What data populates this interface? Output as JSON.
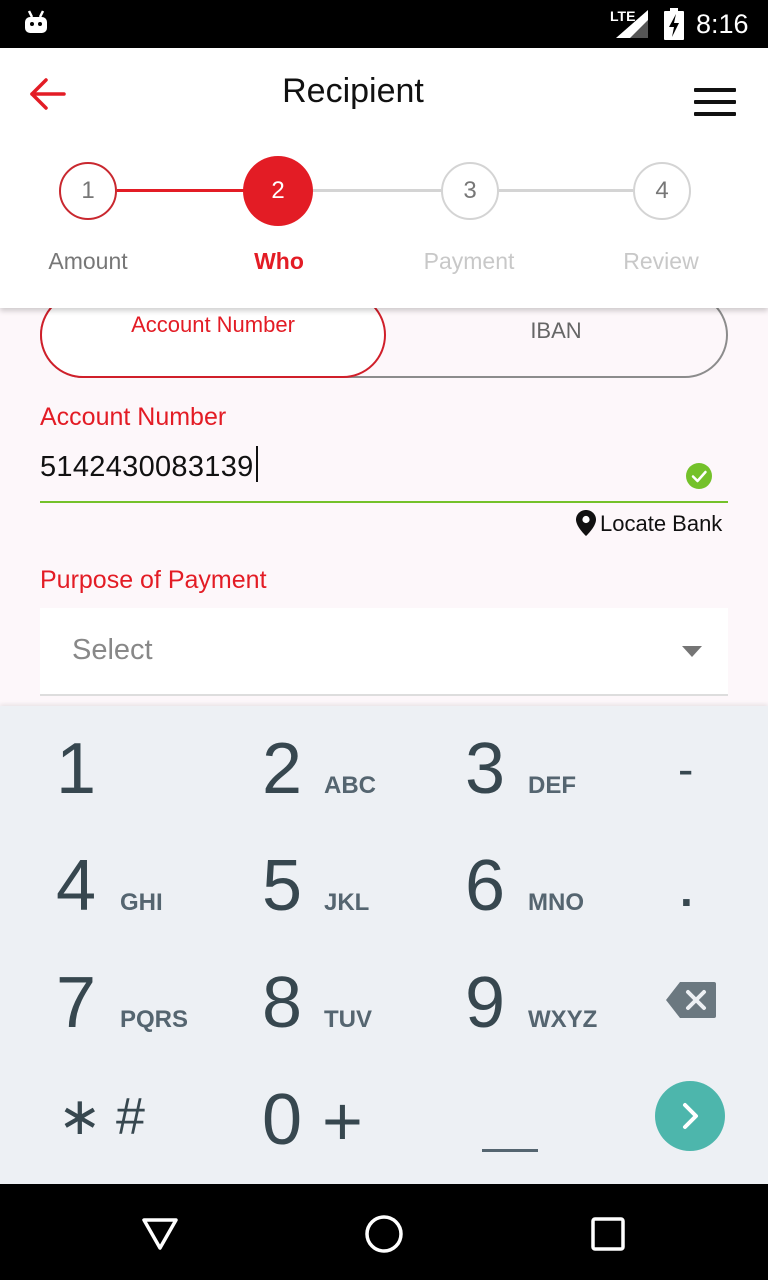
{
  "status_bar": {
    "time": "8:16",
    "network": "LTE",
    "icons": [
      "android-icon",
      "signal-icon",
      "battery-charging-icon"
    ]
  },
  "header": {
    "title": "Recipient",
    "back_icon": "arrow-left-icon",
    "menu_icon": "hamburger-menu-icon"
  },
  "stepper": {
    "steps": [
      {
        "number": "1",
        "label": "Amount",
        "state": "completed"
      },
      {
        "number": "2",
        "label": "Who",
        "state": "active"
      },
      {
        "number": "3",
        "label": "Payment",
        "state": "upcoming"
      },
      {
        "number": "4",
        "label": "Review",
        "state": "upcoming"
      }
    ]
  },
  "form": {
    "toggle": {
      "active": "Account Number",
      "inactive": "IBAN"
    },
    "account_label": "Account Number",
    "account_value": "5142430083139",
    "locate_bank": "Locate Bank",
    "purpose_label": "Purpose of Payment",
    "purpose_placeholder": "Select"
  },
  "keypad": {
    "keys": [
      {
        "digit": "1",
        "letters": ""
      },
      {
        "digit": "2",
        "letters": "ABC"
      },
      {
        "digit": "3",
        "letters": "DEF"
      },
      {
        "digit": "-",
        "letters": ""
      },
      {
        "digit": "4",
        "letters": "GHI"
      },
      {
        "digit": "5",
        "letters": "JKL"
      },
      {
        "digit": "6",
        "letters": "MNO"
      },
      {
        "digit": ".",
        "letters": ""
      },
      {
        "digit": "7",
        "letters": "PQRS"
      },
      {
        "digit": "8",
        "letters": "TUV"
      },
      {
        "digit": "9",
        "letters": "WXYZ"
      },
      {
        "digit": "0",
        "letters": ""
      }
    ],
    "star_hash": "∗ #",
    "plus": "+",
    "space": "__"
  },
  "colors": {
    "accent": "#e31c25",
    "success": "#74c12a",
    "teal": "#4db6ac",
    "keypad_bg": "#edf0f4"
  }
}
